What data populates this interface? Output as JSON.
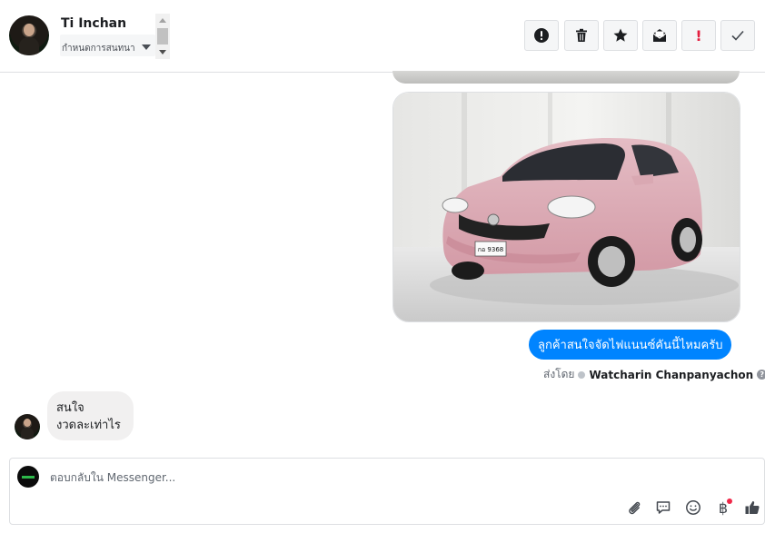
{
  "header": {
    "contact_name": "Ti Inchan",
    "label_select_value": "กำหนดการสนทนา",
    "actions": [
      {
        "name": "mark-spam",
        "icon": "alert-circle-icon"
      },
      {
        "name": "delete",
        "icon": "trash-icon"
      },
      {
        "name": "star",
        "icon": "star-icon"
      },
      {
        "name": "mark-unread",
        "icon": "envelope-icon"
      },
      {
        "name": "follow-up",
        "icon": "exclamation-icon"
      },
      {
        "name": "done",
        "icon": "check-icon"
      }
    ],
    "alert_glyph": "!"
  },
  "messages": {
    "outgoing_text": "ลูกค้าสนใจจัดไฟแนนซ์คันนี้ไหมครับ",
    "sent_by_prefix": "ส่งโดย",
    "sent_by_name": "Watcharin Chanpanyachon",
    "help_glyph": "?",
    "incoming_line1": "สนใจ",
    "incoming_line2": "งวดละเท่าไร",
    "car_plate": "กอ 9368"
  },
  "composer": {
    "placeholder": "ตอบกลับใน Messenger...",
    "icons": [
      "paperclip-icon",
      "saved-replies-icon",
      "emoji-icon",
      "payment-icon",
      "like-icon"
    ],
    "payment_glyph": "฿"
  },
  "colors": {
    "accent": "#0084ff",
    "follow_up_red": "#e41e3f",
    "bubble_in": "#f1f0f0",
    "border": "#dddfe2"
  }
}
